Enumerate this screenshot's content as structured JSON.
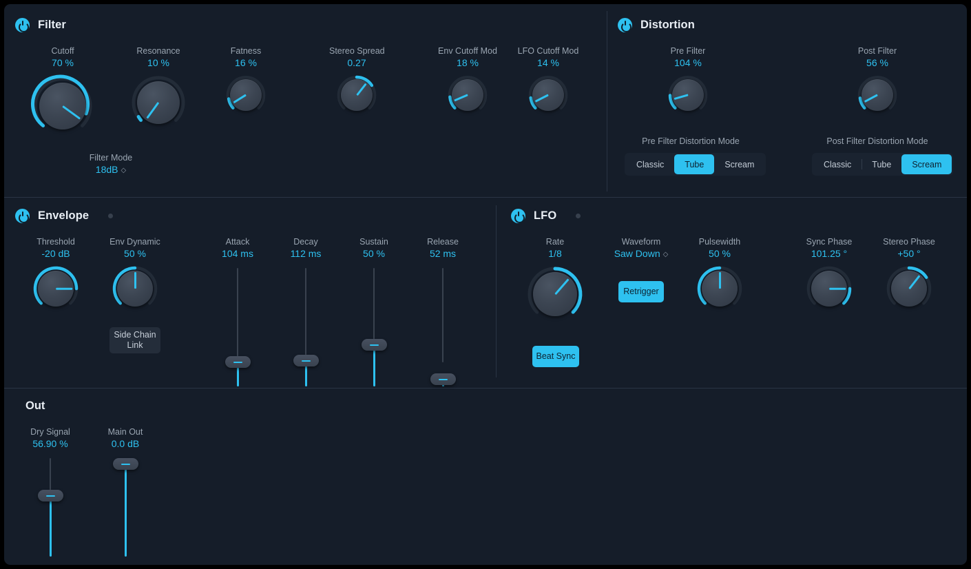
{
  "window": {
    "bg": "#151d29",
    "accent": "#2ec1f0"
  },
  "sections": {
    "filter": {
      "title": "Filter",
      "power": "power-icon"
    },
    "distortion": {
      "title": "Distortion",
      "power": "power-icon"
    },
    "envelope": {
      "title": "Envelope",
      "power": "power-icon"
    },
    "lfo": {
      "title": "LFO",
      "power": "power-icon"
    },
    "out": {
      "title": "Out"
    }
  },
  "filter": {
    "cutoff": {
      "label": "Cutoff",
      "value": "70 %"
    },
    "resonance": {
      "label": "Resonance",
      "value": "10 %"
    },
    "fatness": {
      "label": "Fatness",
      "value": "16 %"
    },
    "stereo_spread": {
      "label": "Stereo Spread",
      "value": "0.27"
    },
    "env_cutoff": {
      "label": "Env Cutoff Mod",
      "value": "18 %"
    },
    "lfo_cutoff": {
      "label": "LFO Cutoff Mod",
      "value": "14 %"
    },
    "mode": {
      "label": "Filter Mode",
      "value": "18dB"
    }
  },
  "distortion": {
    "pre": {
      "label": "Pre Filter",
      "value": "104 %"
    },
    "post": {
      "label": "Post Filter",
      "value": "56 %"
    },
    "pre_mode": {
      "label": "Pre Filter Distortion Mode",
      "options": [
        "Classic",
        "Tube",
        "Scream"
      ],
      "selected": "Tube"
    },
    "post_mode": {
      "label": "Post Filter Distortion Mode",
      "options": [
        "Classic",
        "Tube",
        "Scream"
      ],
      "selected": "Scream"
    }
  },
  "envelope": {
    "threshold": {
      "label": "Threshold",
      "value": "-20 dB"
    },
    "env_dynamic": {
      "label": "Env Dynamic",
      "value": "50 %"
    },
    "side_chain": {
      "label": "Side Chain Link",
      "line1": "Side Chain",
      "line2": "Link"
    },
    "attack": {
      "label": "Attack",
      "value": "104 ms"
    },
    "decay": {
      "label": "Decay",
      "value": "112 ms"
    },
    "sustain": {
      "label": "Sustain",
      "value": "50 %"
    },
    "release": {
      "label": "Release",
      "value": "52 ms"
    }
  },
  "lfo": {
    "rate": {
      "label": "Rate",
      "value": "1/8"
    },
    "beat_sync": {
      "label": "Beat Sync"
    },
    "waveform": {
      "label": "Waveform",
      "value": "Saw Down"
    },
    "retrigger": {
      "label": "Retrigger"
    },
    "pulsewidth": {
      "label": "Pulsewidth",
      "value": "50 %"
    },
    "sync_phase": {
      "label": "Sync Phase",
      "value": "101.25 °"
    },
    "stereo_phase": {
      "label": "Stereo Phase",
      "value": "+50 °"
    }
  },
  "out": {
    "dry": {
      "label": "Dry Signal",
      "value": "56.90 %"
    },
    "main": {
      "label": "Main Out",
      "value": "0.0 dB"
    }
  }
}
